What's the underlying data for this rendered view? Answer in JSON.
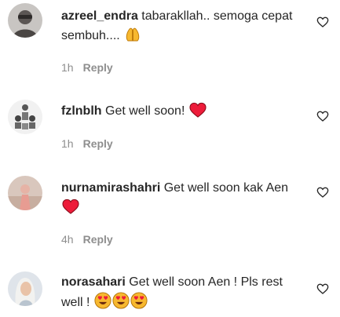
{
  "comments": [
    {
      "username": "azreel_endra",
      "text": "tabarakllah.. semoga cepat sembuh....",
      "emoji": "folded-hands-emoji",
      "time": "1h",
      "reply_label": "Reply"
    },
    {
      "username": "fzlnblh",
      "text": "Get well soon!",
      "emoji": "red-heart-emoji",
      "time": "1h",
      "reply_label": "Reply"
    },
    {
      "username": "nurnamirashahri",
      "text": "Get well soon kak Aen",
      "emoji": "red-heart-emoji",
      "time": "4h",
      "reply_label": "Reply"
    },
    {
      "username": "norasahari",
      "text": "Get well soon Aen ! Pls rest well !",
      "emoji": "heart-eyes-emoji",
      "time": "",
      "reply_label": ""
    }
  ],
  "colors": {
    "text": "#262626",
    "meta": "#8e8e8e",
    "heart": "#ed1c3a",
    "emoji_yellow": "#f7b82f"
  }
}
